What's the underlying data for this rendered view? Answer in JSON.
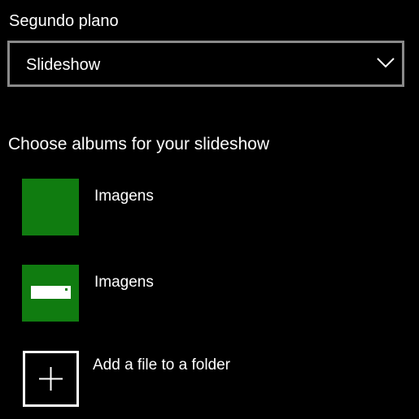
{
  "background": {
    "label": "Segundo plano",
    "dropdown": {
      "selected": "Slideshow",
      "icon": "chevron-down-icon"
    }
  },
  "albums": {
    "heading": "Choose albums for your slideshow",
    "items": [
      {
        "label": "Imagens",
        "thumb_color": "#107c10",
        "icon": "none"
      },
      {
        "label": "Imagens",
        "thumb_color": "#107c10",
        "icon": "drive-icon"
      }
    ],
    "add": {
      "label": "Add a file to a folder",
      "icon": "plus-icon"
    }
  },
  "colors": {
    "background": "#000000",
    "text": "#ffffff",
    "accent": "#107c10",
    "dropdown_border": "#8a8a8a"
  }
}
